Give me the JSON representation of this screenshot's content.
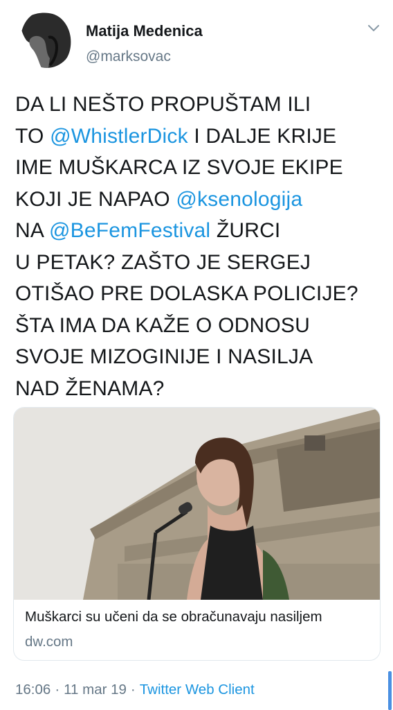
{
  "author": {
    "name": "Matija Medenica",
    "handle": "@marksovac"
  },
  "tweet": {
    "lines": [
      [
        "DA LI NEŠTO PROPUŠTAM ILI"
      ],
      [
        "TO ",
        "@WhistlerDick",
        " I DALJE KRIJE"
      ],
      [
        "IME MUŠKARCA IZ SVOJE EKIPE"
      ],
      [
        "KOJI JE NAPAO ",
        "@ksenologija"
      ],
      [
        "NA ",
        "@BeFemFestival",
        " ŽURCI"
      ],
      [
        "U PETAK? ZAŠTO JE SERGEJ"
      ],
      [
        "OTIŠAO PRE DOLASKA POLICIJE?"
      ],
      [
        "ŠTA IMA DA KAŽE O ODNOSU"
      ],
      [
        "SVOJE MIZOGINIJE I NASILJA"
      ],
      [
        "NAD ŽENAMA?"
      ]
    ],
    "l1": "DA LI NEŠTO PROPUŠTAM ILI",
    "l2a": "TO ",
    "m1": "@WhistlerDick",
    "l2b": " I DALJE KRIJE",
    "l3": "IME MUŠKARCA IZ SVOJE EKIPE",
    "l4a": "KOJI JE NAPAO ",
    "m2": "@ksenologija",
    "l5a": "NA ",
    "m3": "@BeFemFestival",
    "l5b": " ŽURCI",
    "l6": "U PETAK? ZAŠTO JE SERGEJ",
    "l7": "OTIŠAO PRE DOLASKA POLICIJE?",
    "l8": "ŠTA IMA DA KAŽE O ODNOSU",
    "l9": "SVOJE MIZOGINIJE I NASILJA",
    "l10": "NAD ŽENAMA?"
  },
  "card": {
    "title": "Muškarci su učeni da se obračunavaju nasiljem",
    "domain": "dw.com"
  },
  "meta": {
    "time": "16:06",
    "date": "11 mar 19",
    "separator": "·",
    "source": "Twitter Web Client"
  },
  "colors": {
    "mention": "#1b95e0",
    "secondary_text": "#657786",
    "primary_text": "#14171a"
  },
  "icons": {
    "caret": "chevron-down-icon"
  }
}
